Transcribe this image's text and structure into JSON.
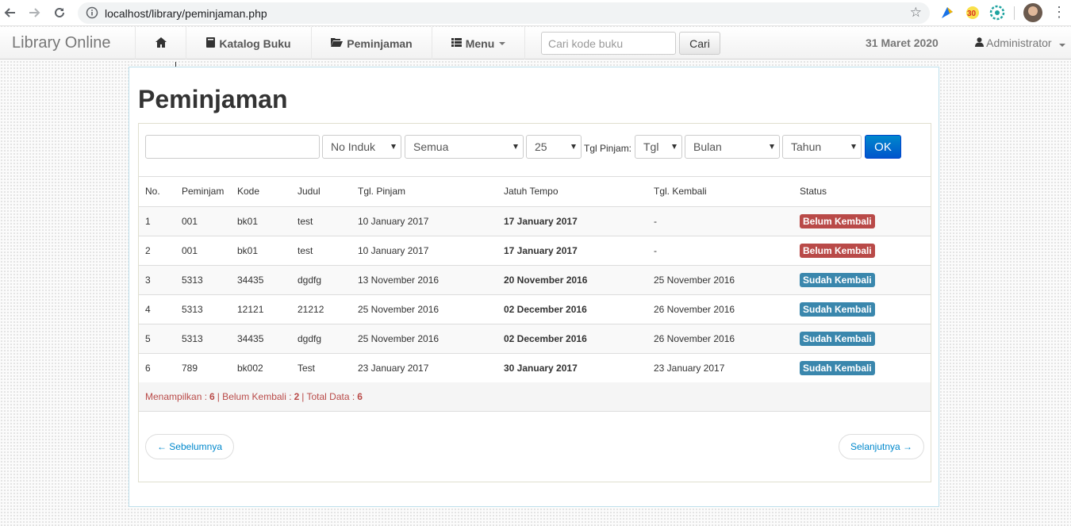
{
  "browser": {
    "url": "localhost/library/peminjaman.php"
  },
  "navbar": {
    "brand": "Library Online",
    "katalog_label": "Katalog Buku",
    "peminjaman_label": "Peminjaman",
    "menu_label": "Menu",
    "search_placeholder": "Cari kode buku",
    "search_button": "Cari",
    "date": "31 Maret 2020",
    "user": "Administrator"
  },
  "page": {
    "title": "Peminjaman"
  },
  "filters": {
    "search_value": "",
    "field_select": "No Induk",
    "status_select": "Semua",
    "limit_select": "25",
    "tgl_pinjam_label": "Tgl Pinjam:",
    "day_select": "Tgl",
    "month_select": "Bulan",
    "year_select": "Tahun",
    "ok_button": "OK"
  },
  "table": {
    "headers": [
      "No.",
      "Peminjam",
      "Kode",
      "Judul",
      "Tgl. Pinjam",
      "Jatuh Tempo",
      "Tgl. Kembali",
      "Status"
    ],
    "rows": [
      {
        "no": "1",
        "peminjam": "001",
        "kode": "bk01",
        "judul": "test",
        "tgl_pinjam": "10 January 2017",
        "jatuh_tempo": "17 January 2017",
        "tgl_kembali": "-",
        "status": "Belum Kembali"
      },
      {
        "no": "2",
        "peminjam": "001",
        "kode": "bk01",
        "judul": "test",
        "tgl_pinjam": "10 January 2017",
        "jatuh_tempo": "17 January 2017",
        "tgl_kembali": "-",
        "status": "Belum Kembali"
      },
      {
        "no": "3",
        "peminjam": "5313",
        "kode": "34435",
        "judul": "dgdfg",
        "tgl_pinjam": "13 November 2016",
        "jatuh_tempo": "20 November 2016",
        "tgl_kembali": "25 November 2016",
        "status": "Sudah Kembali"
      },
      {
        "no": "4",
        "peminjam": "5313",
        "kode": "12121",
        "judul": "21212",
        "tgl_pinjam": "25 November 2016",
        "jatuh_tempo": "02 December 2016",
        "tgl_kembali": "26 November 2016",
        "status": "Sudah Kembali"
      },
      {
        "no": "5",
        "peminjam": "5313",
        "kode": "34435",
        "judul": "dgdfg",
        "tgl_pinjam": "25 November 2016",
        "jatuh_tempo": "02 December 2016",
        "tgl_kembali": "26 November 2016",
        "status": "Sudah Kembali"
      },
      {
        "no": "6",
        "peminjam": "789",
        "kode": "bk002",
        "judul": "Test",
        "tgl_pinjam": "23 January 2017",
        "jatuh_tempo": "30 January 2017",
        "tgl_kembali": "23 January 2017",
        "status": "Sudah Kembali"
      }
    ]
  },
  "summary": {
    "showing_label": "Menampilkan :",
    "showing_value": "6",
    "belum_label": "| Belum Kembali :",
    "belum_value": "2",
    "total_label": "| Total Data :",
    "total_value": "6"
  },
  "pager": {
    "prev": "← Sebelumnya",
    "next": "Selanjutnya →"
  },
  "colors": {
    "belum_kembali": "#b94a48",
    "sudah_kembali": "#3a87ad",
    "ok_button": "#0066cc"
  }
}
